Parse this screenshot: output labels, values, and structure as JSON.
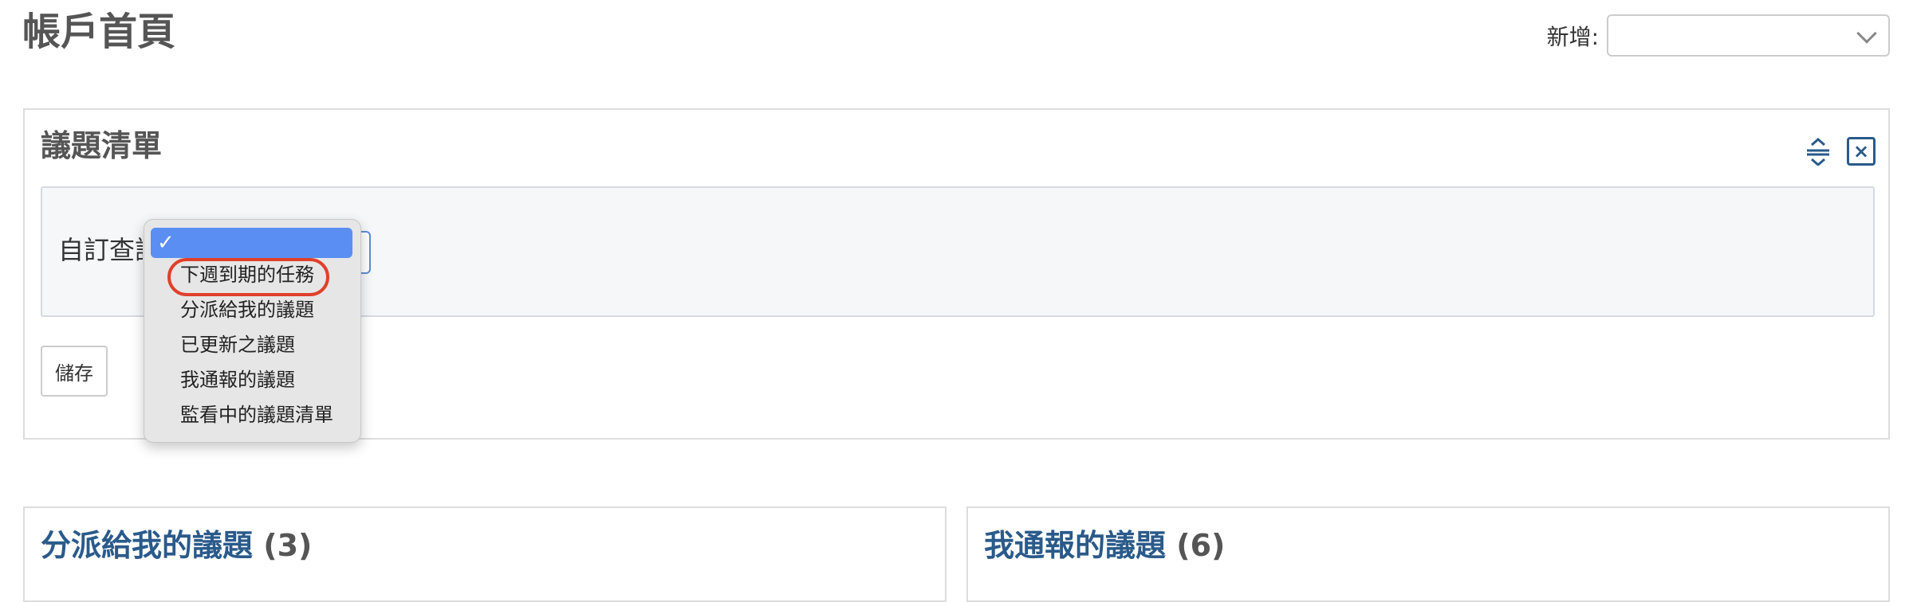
{
  "page": {
    "title": "帳戶首頁"
  },
  "new_menu": {
    "label": "新增:",
    "value": ""
  },
  "issues_box": {
    "title": "議題清單",
    "query_label": "自訂查詢",
    "save_label": "儲存",
    "dropdown": {
      "selected_mark": "✓",
      "items": [
        "下週到期的任務",
        "分派給我的議題",
        "已更新之議題",
        "我通報的議題",
        "監看中的議題清單"
      ],
      "highlighted_item": "下週到期的任務"
    }
  },
  "cards": [
    {
      "title": "分派給我的議題",
      "count": "(3)"
    },
    {
      "title": "我通報的議題",
      "count": "(6)"
    }
  ],
  "colors": {
    "link": "#2a5a8a",
    "dropdown_selection": "#5a8ef2",
    "highlight_ring": "#e0402a"
  },
  "icons": {
    "collapse": "collapse-expand-icon",
    "close": "close-icon"
  }
}
